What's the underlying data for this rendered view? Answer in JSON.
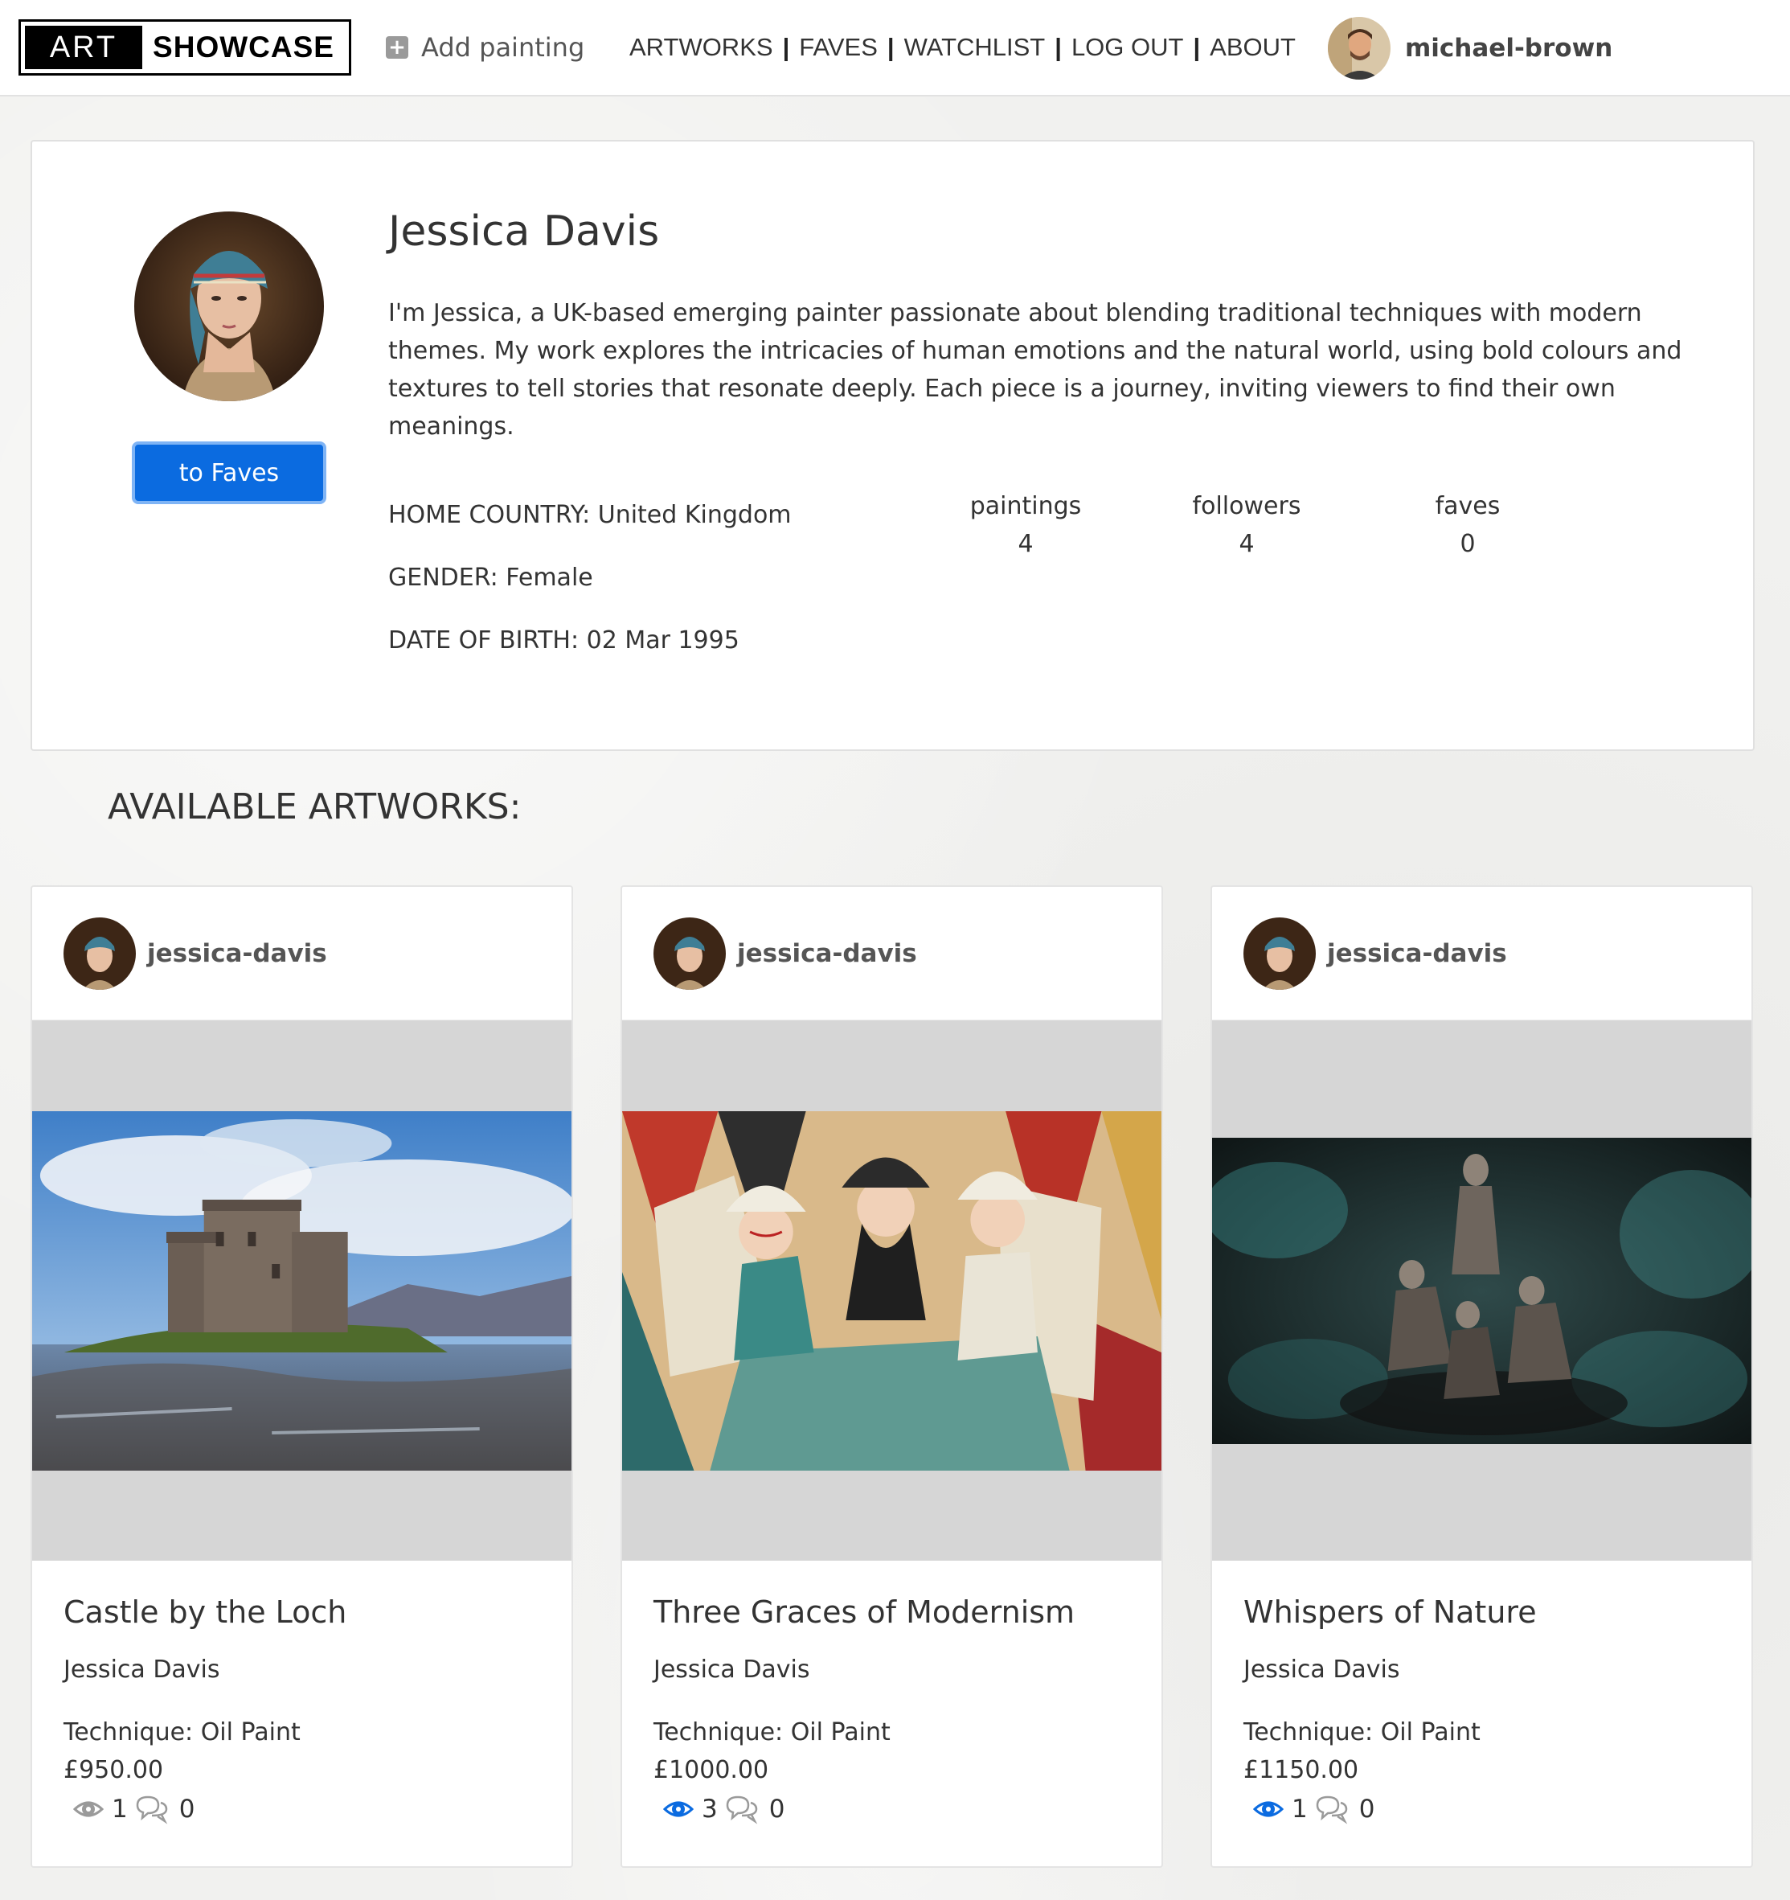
{
  "nav": {
    "logo_art": "ART",
    "logo_showcase": "SHOWCASE",
    "add_painting": "Add painting",
    "links": [
      "ARTWORKS",
      "FAVES",
      "WATCHLIST",
      "LOG OUT",
      "ABOUT"
    ],
    "username": "michael-brown"
  },
  "profile": {
    "name": "Jessica Davis",
    "bio": "I'm Jessica, a UK-based emerging painter passionate about blending traditional techniques with modern themes. My work explores the intricacies of human emotions and the natural world, using bold colours and textures to tell stories that resonate deeply. Each piece is a journey, inviting viewers to find their own meanings.",
    "faves_button": "to Faves",
    "home_country": "HOME COUNTRY: United Kingdom",
    "gender": "GENDER: Female",
    "dob": "DATE OF BIRTH: 02 Mar 1995",
    "stats": [
      {
        "label": "paintings",
        "value": "4"
      },
      {
        "label": "followers",
        "value": "4"
      },
      {
        "label": "faves",
        "value": "0"
      }
    ]
  },
  "section_title": "AVAILABLE ARTWORKS:",
  "artworks": [
    {
      "user": "jessica-davis",
      "title": "Castle by the Loch",
      "artist": "Jessica Davis",
      "technique": "Technique: Oil Paint",
      "price": "£950.00",
      "views": "1",
      "comments": "0",
      "watched": false
    },
    {
      "user": "jessica-davis",
      "title": "Three Graces of Modernism",
      "artist": "Jessica Davis",
      "technique": "Technique: Oil Paint",
      "price": "£1000.00",
      "views": "3",
      "comments": "0",
      "watched": true
    },
    {
      "user": "jessica-davis",
      "title": "Whispers of Nature",
      "artist": "Jessica Davis",
      "technique": "Technique: Oil Paint",
      "price": "£1150.00",
      "views": "1",
      "comments": "0",
      "watched": true
    }
  ],
  "colors": {
    "primary_button": "#0b6be0",
    "watched_eye": "#0b6be0",
    "unwatched_eye": "#9a9a9a"
  }
}
